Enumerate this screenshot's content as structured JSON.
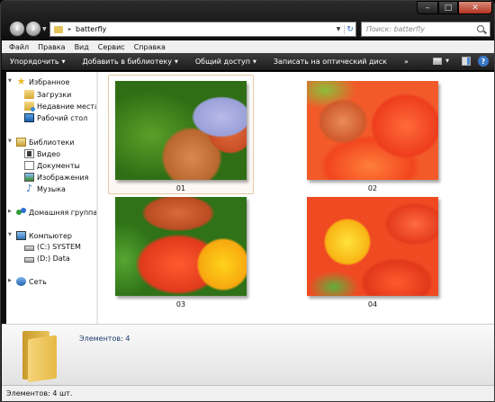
{
  "window": {
    "min_label": "–",
    "max_label": "□",
    "close_label": "✕"
  },
  "address": {
    "path": "batterfly",
    "arrow": "▸"
  },
  "search": {
    "placeholder": "Поиск: batterfly"
  },
  "menu": [
    "Файл",
    "Правка",
    "Вид",
    "Сервис",
    "Справка"
  ],
  "commands": [
    "Упорядочить",
    "Добавить в библиотеку",
    "Общий доступ",
    "Записать на оптический диск"
  ],
  "commands_more": "»",
  "sidebar": {
    "favorites": {
      "label": "Избранное",
      "items": [
        "Загрузки",
        "Недавние места",
        "Рабочий стол"
      ]
    },
    "libraries": {
      "label": "Библиотеки",
      "items": [
        "Видео",
        "Документы",
        "Изображения",
        "Музыка"
      ]
    },
    "homegroup": {
      "label": "Домашняя группа"
    },
    "computer": {
      "label": "Компьютер",
      "items": [
        "(C:) SYSTEM",
        "(D:) Data"
      ]
    },
    "network": {
      "label": "Сеть"
    }
  },
  "files": [
    {
      "name": "01",
      "selected": true
    },
    {
      "name": "02",
      "selected": false
    },
    {
      "name": "03",
      "selected": false
    },
    {
      "name": "04",
      "selected": false
    }
  ],
  "details": {
    "count_text": "Элементов: 4"
  },
  "status": {
    "text": "Элементов: 4 шт."
  },
  "colors": {
    "accent": "#2a63b5",
    "selection_border": "#e4c9a8",
    "cmdbar": "#2b2b2b",
    "folder": "#e7b946"
  }
}
